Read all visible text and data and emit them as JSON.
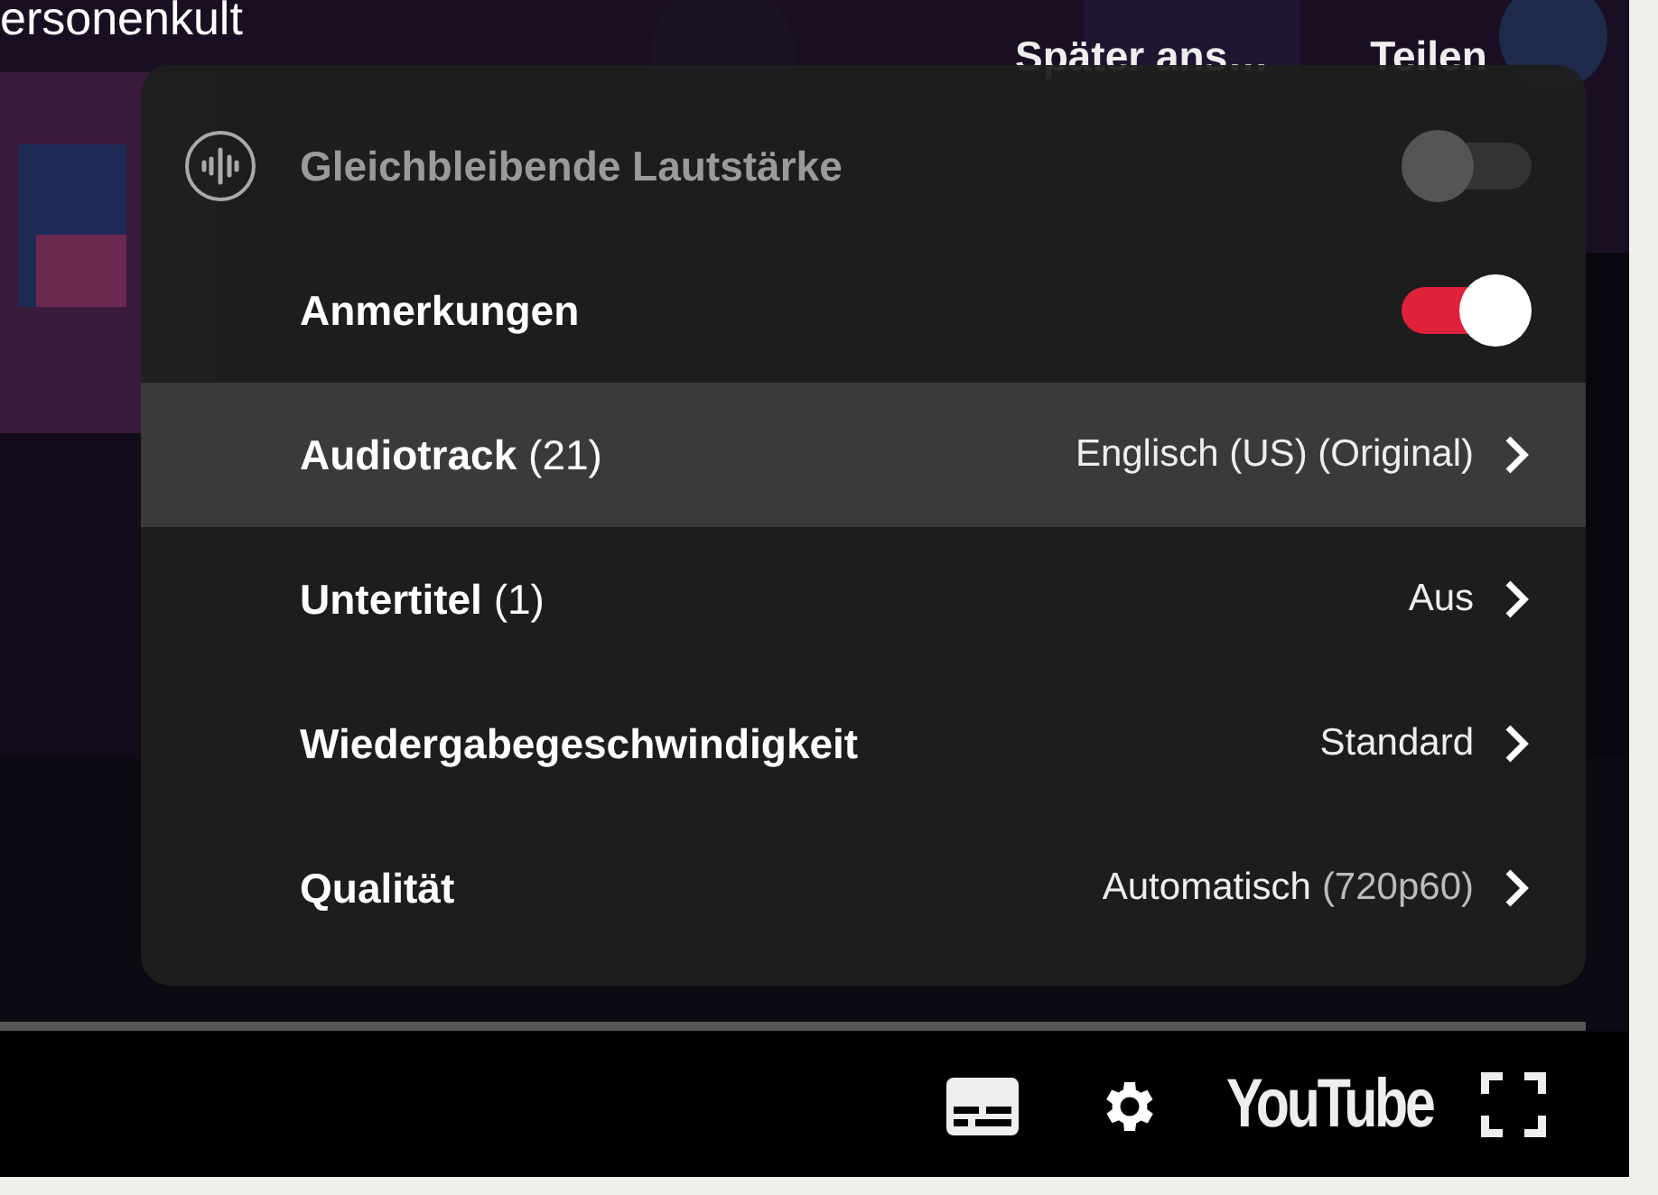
{
  "video_title": "ersonenkult",
  "top_actions": [
    "Später ans…",
    "Teilen"
  ],
  "menu": {
    "items": [
      {
        "kind": "toggle",
        "label": "Gleichbleibende Lautstärke",
        "on": false,
        "disabled": true,
        "selected": false
      },
      {
        "kind": "toggle",
        "label": "Anmerkungen",
        "on": true,
        "disabled": false,
        "selected": false
      },
      {
        "kind": "submenu",
        "label": "**Audiotrack** (21)",
        "value": "Englisch (US) (Original)",
        "selected": true
      },
      {
        "kind": "submenu",
        "label": "**Untertitel** (1)",
        "value": "Aus",
        "selected": false
      },
      {
        "kind": "submenu",
        "label": "**Wiedergabegeschwindigkeit**",
        "value": "Standard",
        "selected": false
      },
      {
        "kind": "submenu",
        "label": "**Qualität**",
        "value": "Automatisch",
        "value_note": "(720p60)",
        "selected": false
      }
    ]
  },
  "brand": "YouTube"
}
